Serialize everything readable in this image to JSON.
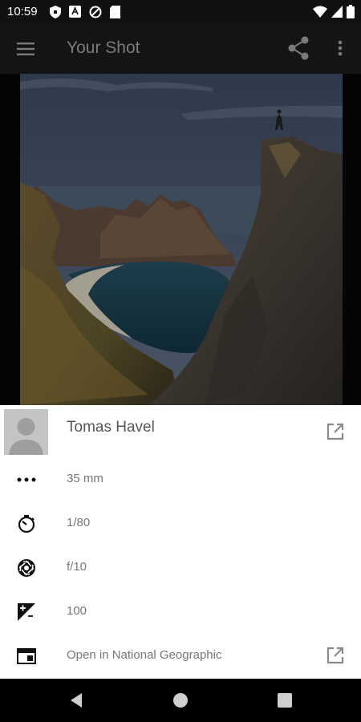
{
  "status_bar": {
    "time": "10:59"
  },
  "app_bar": {
    "title": "Your Shot"
  },
  "photo": {
    "accent_sky": "#3a4456",
    "accent_water": "#15323f"
  },
  "author": {
    "name": "Tomas Havel"
  },
  "exif": [
    {
      "icon": "focal-length-icon",
      "value": "35 mm"
    },
    {
      "icon": "shutter-speed-icon",
      "value": "1/80"
    },
    {
      "icon": "aperture-icon",
      "value": "f/10"
    },
    {
      "icon": "iso-exposure-icon",
      "value": "100"
    }
  ],
  "open_link": {
    "icon": "browser-window-icon",
    "label": "Open in National Geographic"
  },
  "nav_bar": {
    "back": "back-icon",
    "home": "home-icon",
    "recents": "recents-icon"
  }
}
